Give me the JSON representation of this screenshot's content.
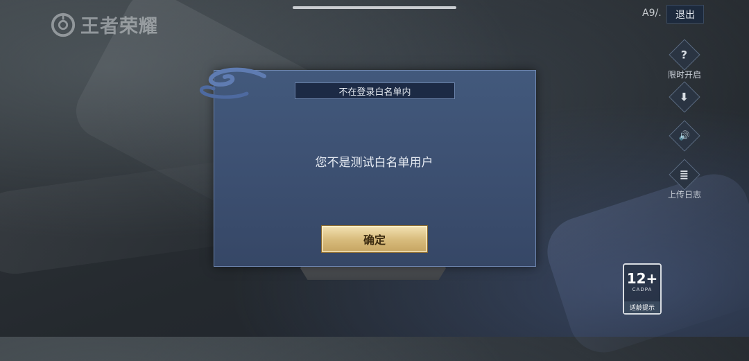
{
  "app": {
    "logo_text": "王者荣耀"
  },
  "header": {
    "version": "A9/.",
    "exit_label": "退出"
  },
  "side_buttons": [
    {
      "icon": "question-icon",
      "glyph": "?",
      "label": "限时开启"
    },
    {
      "icon": "download-icon",
      "glyph": "⬇",
      "label": ""
    },
    {
      "icon": "speaker-icon",
      "glyph": "🔊",
      "label": ""
    },
    {
      "icon": "document-icon",
      "glyph": "≣",
      "label": "上传日志"
    }
  ],
  "dialog": {
    "title": "不在登录白名单内",
    "message": "您不是测试白名单用户",
    "ok_label": "确定"
  },
  "age_badge": {
    "rating": "12+",
    "org": "CADPA",
    "hint": "适龄提示"
  },
  "colors": {
    "dialog_bg": "#3e5274",
    "button_gold": "#d9bd7e",
    "exit_bg": "#1d2a3d"
  }
}
